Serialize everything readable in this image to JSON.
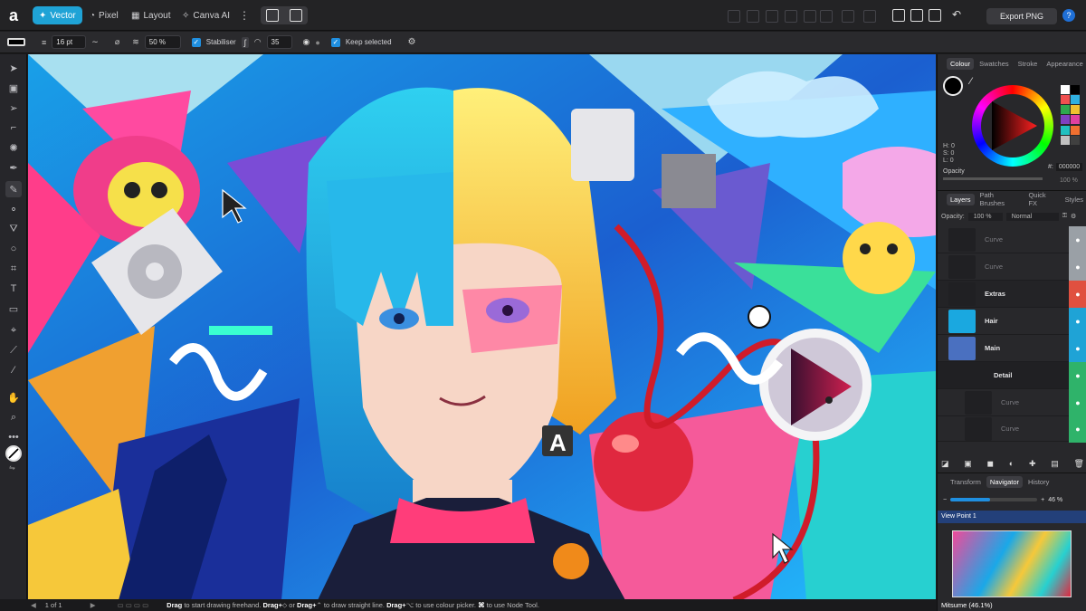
{
  "topbar": {
    "personas": [
      {
        "label": "Vector",
        "icon": "vector-persona-icon",
        "active": true
      },
      {
        "label": "Pixel",
        "icon": "pixel-persona-icon"
      },
      {
        "label": "Layout",
        "icon": "layout-persona-icon"
      },
      {
        "label": "Canva AI",
        "icon": "canva-ai-icon"
      }
    ],
    "export_label": "Export PNG",
    "help": "?"
  },
  "context_bar": {
    "stroke_width": "16 pt",
    "opacity": "50 %",
    "stabiliser_label": "Stabiliser",
    "stabiliser_value": "35",
    "keep_selected_label": "Keep selected"
  },
  "colour_panel": {
    "tabs": [
      "Colour",
      "Swatches",
      "Stroke",
      "Appearance"
    ],
    "active_tab": "Colour",
    "h": "H: 0",
    "s": "S: 0",
    "l": "L: 0",
    "opacity_label": "Opacity",
    "opacity_value": "100 %",
    "hex_label": "#:",
    "hex_value": "000000",
    "swatches": [
      "#ffffff",
      "#000000",
      "#f05050",
      "#30b0e0",
      "#2fa84f",
      "#f0c030",
      "#8040c0",
      "#e040a0",
      "#20c0c0",
      "#f07030",
      "#c0c0c0",
      "#404040"
    ]
  },
  "layers_panel": {
    "tabs": [
      "Layers",
      "Path Brushes",
      "Quick FX",
      "Styles"
    ],
    "active_tab": "Layers",
    "opacity_label": "Opacity:",
    "opacity_value": "100 %",
    "blend_mode": "Normal",
    "layers": [
      {
        "name": "Curve",
        "dim": true,
        "visibility_color": "#9aa0a6"
      },
      {
        "name": "Curve",
        "dim": true,
        "visibility_color": "#9aa0a6"
      },
      {
        "name": "Extras",
        "dim": false,
        "visibility_color": "#e05040"
      },
      {
        "name": "Hair",
        "dim": false,
        "visibility_color": "#1fa3d6"
      },
      {
        "name": "Main",
        "dim": false,
        "visibility_color": "#1fa3d6"
      },
      {
        "name": "Detail",
        "dim": false,
        "visibility_color": "#2fb36a"
      },
      {
        "name": "Curve",
        "dim": true,
        "visibility_color": "#2fb36a"
      },
      {
        "name": "Curve",
        "dim": true,
        "visibility_color": "#2fb36a"
      }
    ]
  },
  "navigator_panel": {
    "tabs": [
      "Transform",
      "Navigator",
      "History"
    ],
    "active_tab": "Navigator",
    "zoom_fraction": 0.46,
    "zoom_value": "46 %",
    "view_point": "View Point 1",
    "doc_title": "Mitsume (46.1%)"
  },
  "status": {
    "page": "1 of 1",
    "hint_drag": "Drag",
    "hint_1": " to start drawing freehand. ",
    "hint_drag2": "Drag+",
    "hint_2": "⬦ or ",
    "hint_drag3": "Drag+",
    "hint_3": "⌃ to draw straight line. ",
    "hint_drag4": "Drag+",
    "hint_4": "⌥ to use colour picker. ",
    "hint_cmd": "⌘",
    "hint_5": " to use Node Tool."
  }
}
